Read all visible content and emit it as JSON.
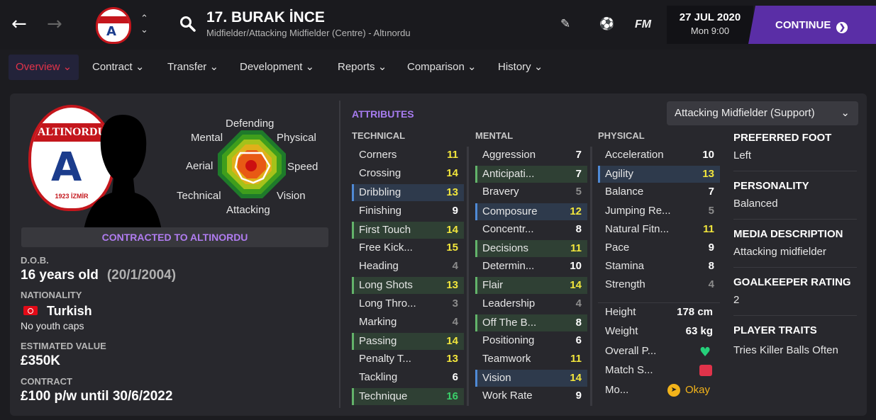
{
  "header": {
    "player_name": "17. BURAK İNCE",
    "player_subtitle": "Midfielder/Attacking Midfielder (Centre) - Altınordu",
    "fm_label": "FM",
    "date": "27 JUL 2020",
    "time": "Mon 9:00",
    "continue_label": "CONTINUE"
  },
  "tabs": [
    {
      "label": "Overview"
    },
    {
      "label": "Contract"
    },
    {
      "label": "Transfer"
    },
    {
      "label": "Development"
    },
    {
      "label": "Reports"
    },
    {
      "label": "Comparison"
    },
    {
      "label": "History"
    }
  ],
  "badge": {
    "band_text": "ALTINORDU",
    "year_text": "1923 İZMİR"
  },
  "radar_labels": {
    "defending": "Defending",
    "mental": "Mental",
    "physical": "Physical",
    "aerial": "Aerial",
    "speed": "Speed",
    "technical": "Technical",
    "vision": "Vision",
    "attacking": "Attacking"
  },
  "contracted_label": "CONTRACTED TO ALTINORDU",
  "profile": {
    "dob_label": "D.O.B.",
    "age": "16 years old",
    "dob": "(20/1/2004)",
    "nationality_label": "NATIONALITY",
    "nationality": "Turkish",
    "youth_caps": "No youth caps",
    "value_label": "ESTIMATED VALUE",
    "value": "£350K",
    "contract_label": "CONTRACT",
    "contract": "£100 p/w until 30/6/2022"
  },
  "attributes": {
    "title": "ATTRIBUTES",
    "role": "Attacking Midfielder (Support)",
    "technical_header": "TECHNICAL",
    "mental_header": "MENTAL",
    "physical_header": "PHYSICAL",
    "technical": [
      {
        "name": "Corners",
        "value": "11",
        "hl": ""
      },
      {
        "name": "Crossing",
        "value": "14",
        "hl": ""
      },
      {
        "name": "Dribbling",
        "value": "13",
        "hl": "b"
      },
      {
        "name": "Finishing",
        "value": "9",
        "hl": ""
      },
      {
        "name": "First Touch",
        "value": "14",
        "hl": "g"
      },
      {
        "name": "Free Kick...",
        "value": "15",
        "hl": ""
      },
      {
        "name": "Heading",
        "value": "4",
        "hl": ""
      },
      {
        "name": "Long Shots",
        "value": "13",
        "hl": "g"
      },
      {
        "name": "Long Thro...",
        "value": "3",
        "hl": ""
      },
      {
        "name": "Marking",
        "value": "4",
        "hl": ""
      },
      {
        "name": "Passing",
        "value": "14",
        "hl": "g"
      },
      {
        "name": "Penalty T...",
        "value": "13",
        "hl": ""
      },
      {
        "name": "Tackling",
        "value": "6",
        "hl": ""
      },
      {
        "name": "Technique",
        "value": "16",
        "hl": "g"
      }
    ],
    "mental": [
      {
        "name": "Aggression",
        "value": "7",
        "hl": ""
      },
      {
        "name": "Anticipati...",
        "value": "7",
        "hl": "g"
      },
      {
        "name": "Bravery",
        "value": "5",
        "hl": ""
      },
      {
        "name": "Composure",
        "value": "12",
        "hl": "b"
      },
      {
        "name": "Concentr...",
        "value": "8",
        "hl": ""
      },
      {
        "name": "Decisions",
        "value": "11",
        "hl": "g"
      },
      {
        "name": "Determin...",
        "value": "10",
        "hl": ""
      },
      {
        "name": "Flair",
        "value": "14",
        "hl": "g"
      },
      {
        "name": "Leadership",
        "value": "4",
        "hl": ""
      },
      {
        "name": "Off The B...",
        "value": "8",
        "hl": "g"
      },
      {
        "name": "Positioning",
        "value": "6",
        "hl": ""
      },
      {
        "name": "Teamwork",
        "value": "11",
        "hl": ""
      },
      {
        "name": "Vision",
        "value": "14",
        "hl": "b"
      },
      {
        "name": "Work Rate",
        "value": "9",
        "hl": ""
      }
    ],
    "physical": [
      {
        "name": "Acceleration",
        "value": "10",
        "hl": ""
      },
      {
        "name": "Agility",
        "value": "13",
        "hl": "b"
      },
      {
        "name": "Balance",
        "value": "7",
        "hl": ""
      },
      {
        "name": "Jumping Re...",
        "value": "5",
        "hl": ""
      },
      {
        "name": "Natural Fitn...",
        "value": "11",
        "hl": ""
      },
      {
        "name": "Pace",
        "value": "9",
        "hl": ""
      },
      {
        "name": "Stamina",
        "value": "8",
        "hl": ""
      },
      {
        "name": "Strength",
        "value": "4",
        "hl": ""
      }
    ],
    "extra": {
      "height_label": "Height",
      "height": "178 cm",
      "weight_label": "Weight",
      "weight": "63 kg",
      "overall_label": "Overall P...",
      "match_label": "Match S...",
      "morale_label": "Mo...",
      "morale": "Okay"
    }
  },
  "side": {
    "foot_label": "PREFERRED FOOT",
    "foot": "Left",
    "personality_label": "PERSONALITY",
    "personality": "Balanced",
    "media_label": "MEDIA DESCRIPTION",
    "media": "Attacking midfielder",
    "gk_label": "GOALKEEPER RATING",
    "gk": "2",
    "traits_label": "PLAYER TRAITS",
    "traits": "Tries Killer Balls Often"
  },
  "colors": {
    "accent": "#5a2ea6",
    "attr_yellow": "#f2e63c",
    "attr_green": "#3ad06a",
    "attr_white": "#ffffff",
    "attr_grey": "#8c8c8c",
    "active_tab": "#e2334a"
  }
}
